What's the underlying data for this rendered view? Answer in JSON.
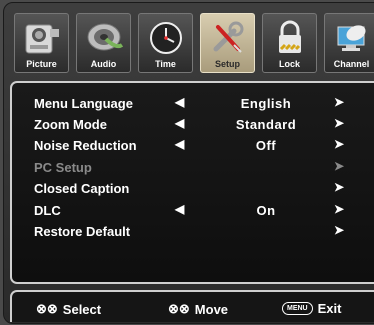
{
  "tabs": [
    {
      "label": "Picture",
      "icon": "tv-camera-icon",
      "active": false
    },
    {
      "label": "Audio",
      "icon": "speaker-icon",
      "active": false
    },
    {
      "label": "Time",
      "icon": "clock-icon",
      "active": false
    },
    {
      "label": "Setup",
      "icon": "wrench-screwdriver-icon",
      "active": true
    },
    {
      "label": "Lock",
      "icon": "padlock-icon",
      "active": false
    },
    {
      "label": "Channel",
      "icon": "satellite-dish-icon",
      "active": false
    }
  ],
  "menu": [
    {
      "label": "Menu Language",
      "value": "English",
      "left_arrow": "◀",
      "right_arrow": "➤",
      "enabled": true
    },
    {
      "label": "Zoom Mode",
      "value": "Standard",
      "left_arrow": "◀",
      "right_arrow": "➤",
      "enabled": true
    },
    {
      "label": "Noise Reduction",
      "value": "Off",
      "left_arrow": "◀",
      "right_arrow": "➤",
      "enabled": true
    },
    {
      "label": "PC Setup",
      "value": "",
      "left_arrow": "",
      "right_arrow": "➤",
      "enabled": false
    },
    {
      "label": "Closed Caption",
      "value": "",
      "left_arrow": "",
      "right_arrow": "➤",
      "enabled": true
    },
    {
      "label": "DLC",
      "value": "On",
      "left_arrow": "◀",
      "right_arrow": "➤",
      "enabled": true
    },
    {
      "label": "Restore Default",
      "value": "",
      "left_arrow": "",
      "right_arrow": "➤",
      "enabled": true
    }
  ],
  "footer": {
    "select_keys": "⊗⊗",
    "select_label": "Select",
    "move_keys": "⊗⊗",
    "move_label": "Move",
    "menu_key": "MENU",
    "exit_label": "Exit"
  },
  "colors": {
    "active_tab": "#c8bc9b",
    "panel_border": "#cfcfcf",
    "disabled_text": "#8a8a8a"
  }
}
